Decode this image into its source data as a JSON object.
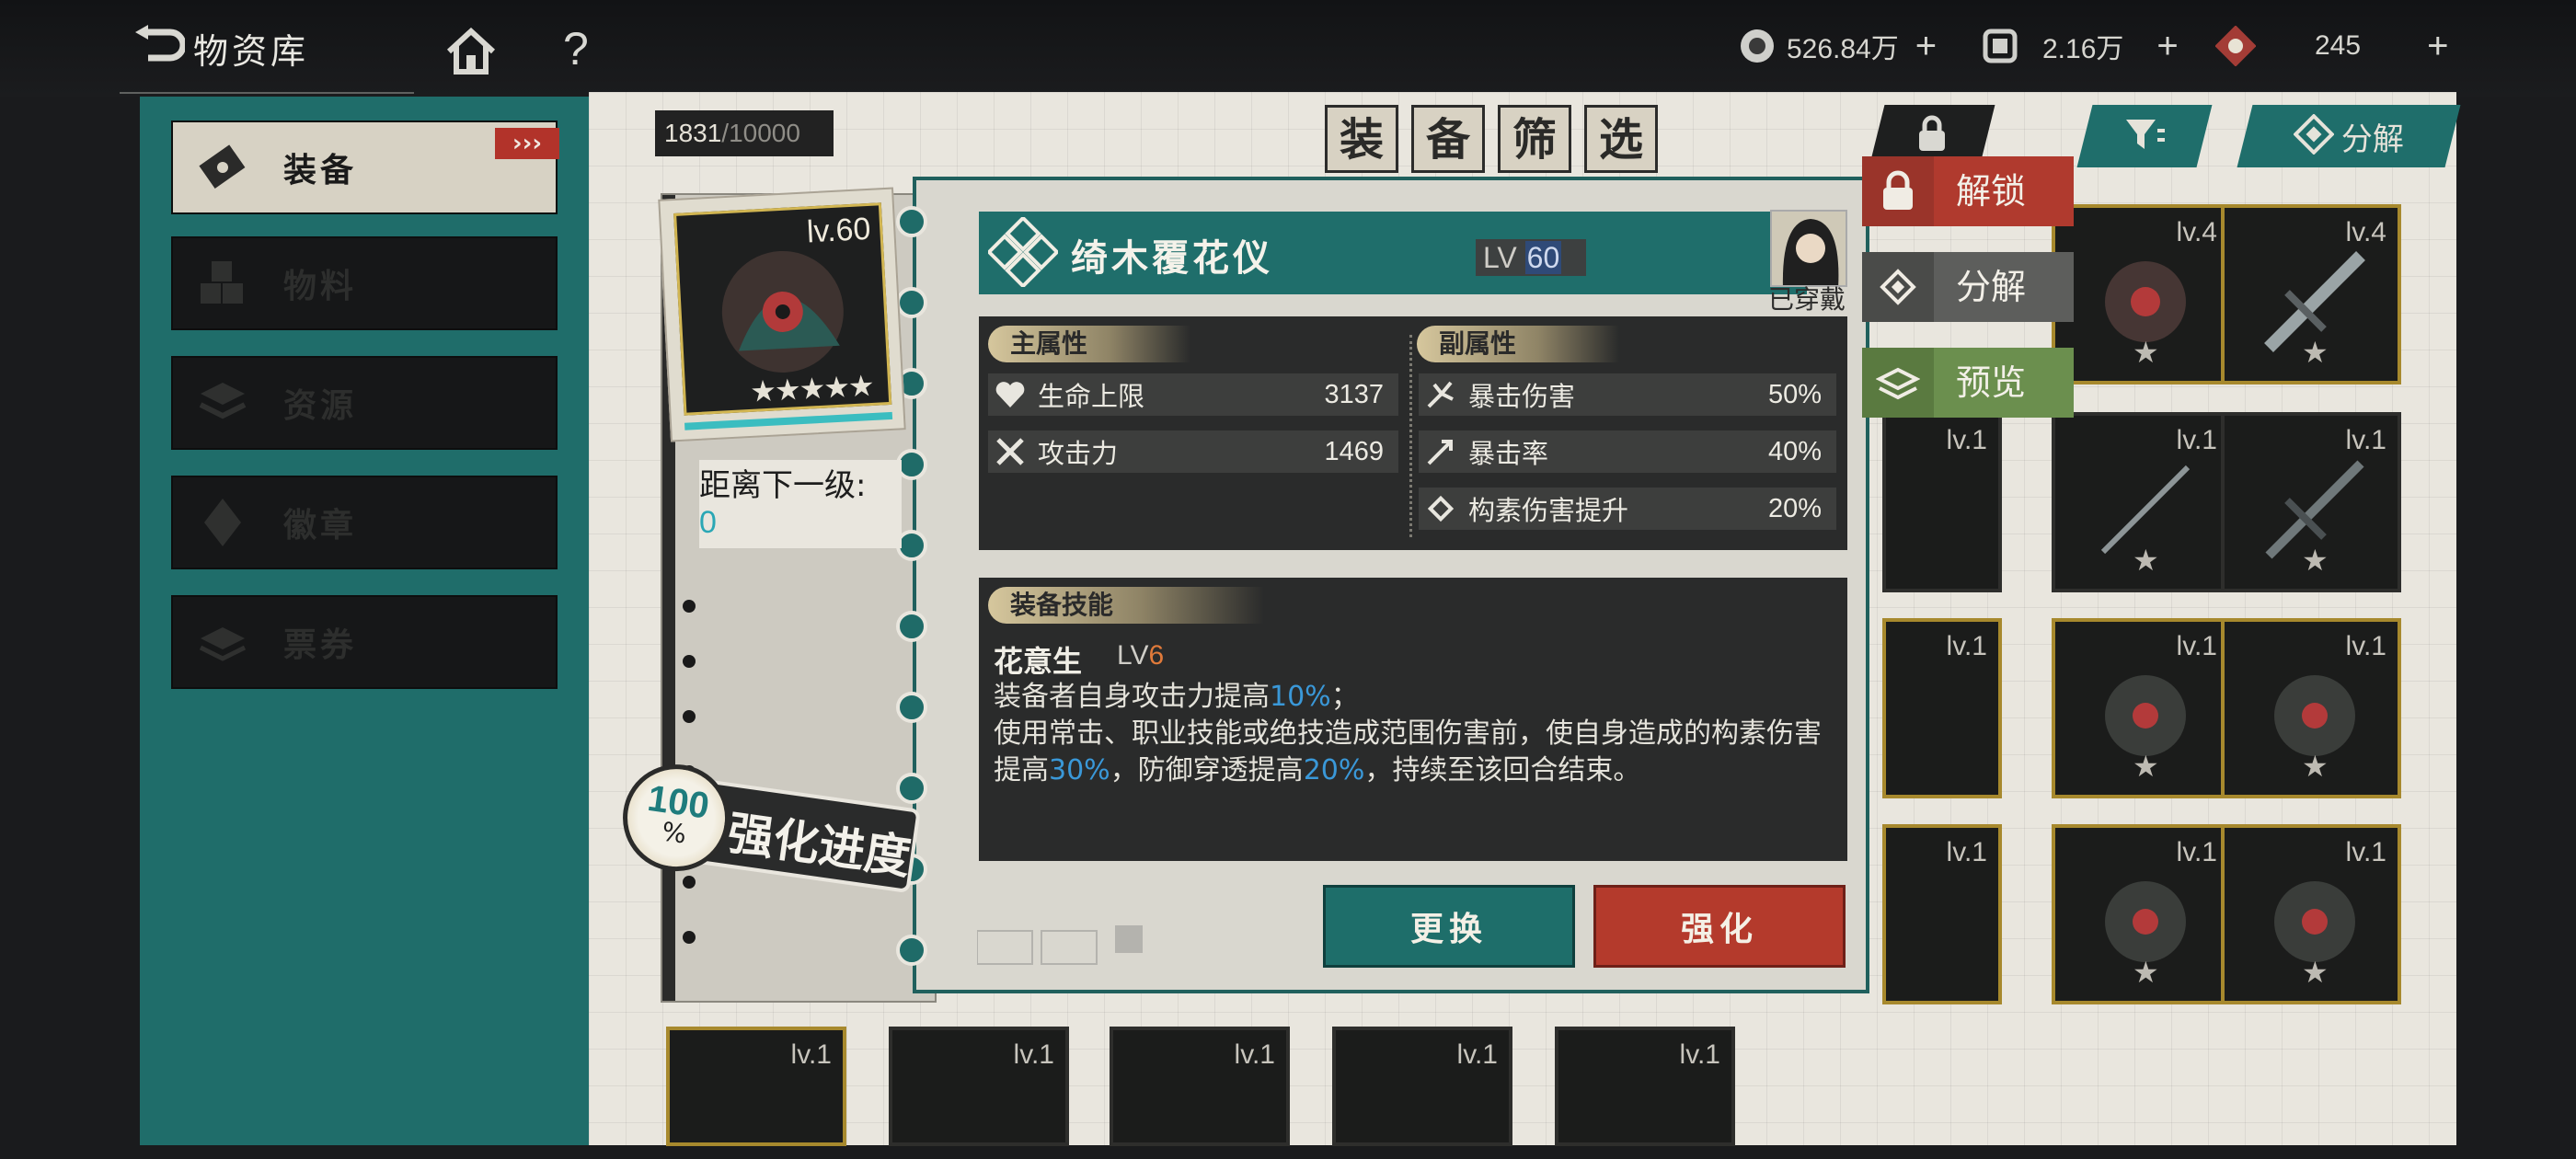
{
  "header": {
    "title": "物资库",
    "help": "?",
    "resources": [
      {
        "icon": "coin-icon",
        "value": "526.84万",
        "plus": "+"
      },
      {
        "icon": "material-icon",
        "value": "2.16万",
        "plus": "+"
      },
      {
        "icon": "crystal-icon",
        "value": "245",
        "plus": "+"
      }
    ]
  },
  "sidebar": {
    "items": [
      {
        "label": "装备",
        "icon": "equipment-icon",
        "arrow": "›››"
      },
      {
        "label": "物料",
        "icon": "material-cubes-icon"
      },
      {
        "label": "资源",
        "icon": "resource-stack-icon"
      },
      {
        "label": "徽章",
        "icon": "badge-icon"
      },
      {
        "label": "票券",
        "icon": "ticket-icon"
      }
    ]
  },
  "board": {
    "capacity_current": "1831",
    "capacity_max": "/10000",
    "filter_chars": [
      "装",
      "备",
      "筛",
      "选"
    ],
    "tab_decompose": "分解",
    "cards": [
      {
        "lv": "lv.4"
      },
      {
        "lv": "lv.4"
      },
      {
        "lv": "lv.1"
      },
      {
        "lv": "lv.1"
      },
      {
        "lv": "lv.1"
      },
      {
        "lv": "lv.1"
      },
      {
        "lv": "lv.1"
      },
      {
        "lv": "lv.1"
      },
      {
        "lv": "lv.1"
      },
      {
        "lv": "lv.1"
      },
      {
        "lv": "lv.1"
      },
      {
        "lv": "lv.1"
      },
      {
        "lv": "lv.1"
      },
      {
        "lv": "lv.1"
      },
      {
        "lv": "lv.1"
      },
      {
        "lv": "lv.1"
      }
    ]
  },
  "portrait": {
    "level": "lv.60",
    "stars": "★★★★★",
    "next_level_label": "距离下一级:",
    "next_level_value": "0",
    "progress_pct": "100",
    "progress_sym": "%",
    "progress_label": "强化进度"
  },
  "detail": {
    "name": "绮木覆花仪",
    "lv_prefix": "LV",
    "lv": "60",
    "equipped_label": "已穿戴",
    "main_attr_title": "主属性",
    "sub_attr_title": "副属性",
    "main_attrs": [
      {
        "name": "生命上限",
        "value": "3137",
        "icon": "heart-icon"
      },
      {
        "name": "攻击力",
        "value": "1469",
        "icon": "crossed-swords-icon"
      }
    ],
    "sub_attrs": [
      {
        "name": "暴击伤害",
        "value": "50%",
        "icon": "crit-damage-icon"
      },
      {
        "name": "暴击率",
        "value": "40%",
        "icon": "crit-rate-icon"
      },
      {
        "name": "构素伤害提升",
        "value": "20%",
        "icon": "element-damage-icon"
      }
    ],
    "skill_title": "装备技能",
    "skill_name": "花意生",
    "skill_lv_prefix": "LV",
    "skill_lv": "6",
    "skill_desc": {
      "l1a": "装备者自身攻击力提高",
      "l1b": "10%",
      "l1c": "；",
      "l2a": "使用常击、职业技能或绝技造成范围伤害前，使自身造成的构素伤害提高",
      "l2b": "30%",
      "l2c": "，防御穿透提高",
      "l2d": "20%",
      "l2e": "，持续至该回合结束。"
    },
    "btn_swap": "更换",
    "btn_enhance": "强化"
  },
  "side_actions": [
    {
      "label": "解锁",
      "icon": "lock-icon",
      "color": "#b03a2e"
    },
    {
      "label": "分解",
      "icon": "decompose-icon",
      "color": "#5d5e5c"
    },
    {
      "label": "预览",
      "icon": "preview-icon",
      "color": "#6b8f4e"
    }
  ],
  "colors": {
    "teal": "#1f6e6b",
    "red": "#b43a2c",
    "highlight_blue": "#3a98d8",
    "level_orange": "#e07a3a"
  }
}
